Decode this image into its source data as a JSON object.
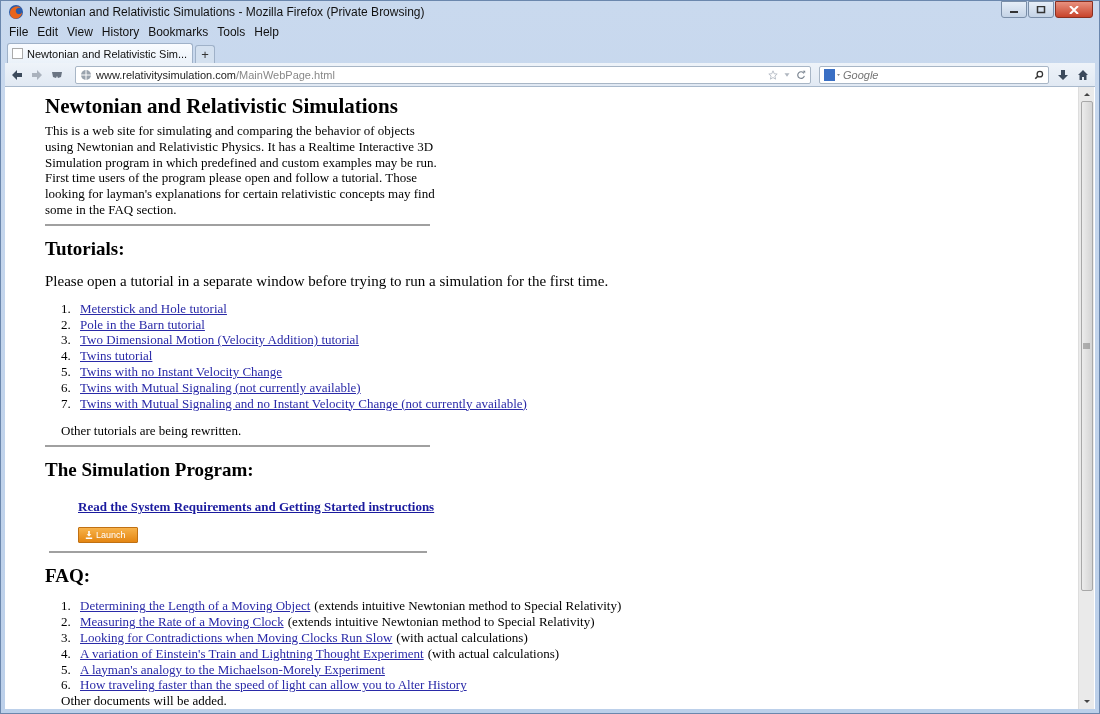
{
  "window": {
    "title": "Newtonian and Relativistic Simulations - Mozilla Firefox (Private Browsing)"
  },
  "menu": [
    "File",
    "Edit",
    "View",
    "History",
    "Bookmarks",
    "Tools",
    "Help"
  ],
  "tabs": [
    {
      "label": "Newtonian and Relativistic Sim...",
      "selected": true
    }
  ],
  "new_tab": "+",
  "address_bar": {
    "domain": "www.relativitysimulation.com",
    "path": "/MainWebPage.html"
  },
  "search": {
    "placeholder": "Google"
  },
  "page": {
    "title": "Newtonian and Relativistic Simulations",
    "intro": "This is a web site for simulating and comparing the behavior of objects using Newtonian and Relativistic Physics. It has a Realtime Interactive 3D Simulation program in which predefined and custom examples may be run. First time users of the program please open and follow a tutorial. Those looking for layman's explanations for certain relativistic concepts may find some in the FAQ section.",
    "tutorials": {
      "heading": "Tutorials:",
      "note": "Please open a tutorial in a separate window before trying to run a simulation for the first time.",
      "items": [
        {
          "number": "1.",
          "link": "Meterstick and Hole tutorial"
        },
        {
          "number": "2.",
          "link": "Pole in the Barn tutorial"
        },
        {
          "number": "3.",
          "link": "Two Dimensional Motion (Velocity Addition) tutorial"
        },
        {
          "number": "4.",
          "link": "Twins tutorial"
        },
        {
          "number": "5.",
          "link": "Twins with no Instant Velocity Change"
        },
        {
          "number": "6.",
          "link": "Twins with Mutual Signaling (not currently available)"
        },
        {
          "number": "7.",
          "link": "Twins with Mutual Signaling and no Instant Velocity Change (not currently available)"
        }
      ],
      "footer": "Other tutorials are being rewritten."
    },
    "program": {
      "heading": "The Simulation Program:",
      "link": "Read the System Requirements and Getting Started instructions",
      "button": "Launch"
    },
    "faq": {
      "heading": "FAQ:",
      "items": [
        {
          "number": "1.",
          "link": "Determining the Length of a Moving Object",
          "note": "(extends intuitive Newtonian method to Special Relativity)"
        },
        {
          "number": "2.",
          "link": "Measuring the Rate of a Moving Clock",
          "note": "(extends intuitive Newtonian method to Special Relativity)"
        },
        {
          "number": "3.",
          "link": "Looking for Contradictions when Moving Clocks Run Slow",
          "note": "(with actual calculations)"
        },
        {
          "number": "4.",
          "link": "A variation of Einstein's Train and Lightning Thought Experiment",
          "note": "(with actual calculations)"
        },
        {
          "number": "5.",
          "link": "A layman's analogy to the Michaelson-Morely Experiment"
        },
        {
          "number": "6.",
          "link": "How traveling faster than the speed of light can allow you to Alter History"
        }
      ],
      "footer": "Other documents will be added."
    }
  }
}
